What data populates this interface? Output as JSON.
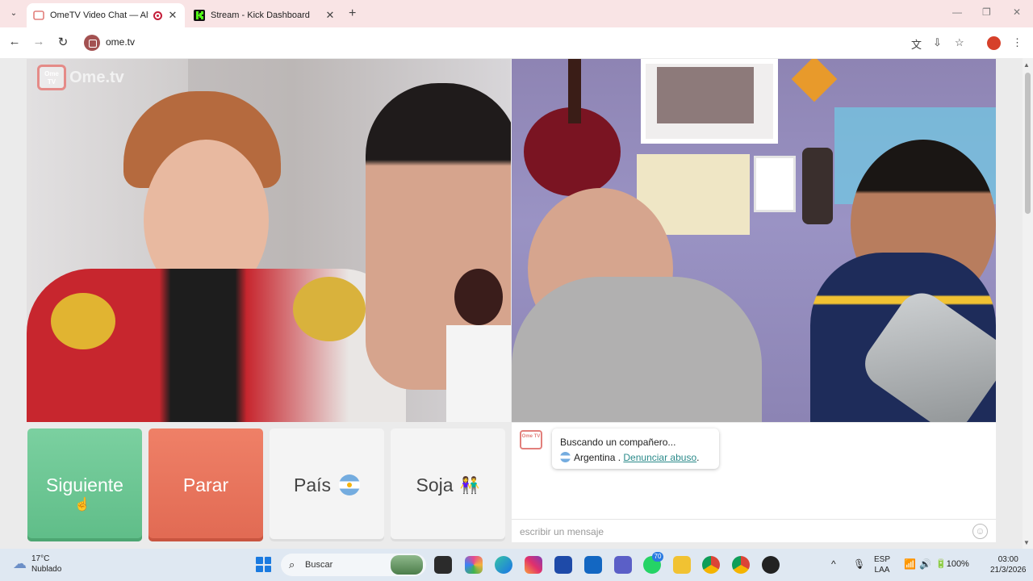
{
  "browser": {
    "tabs": [
      {
        "title": "OmeTV Video Chat — Alter",
        "active": true
      },
      {
        "title": "Stream - Kick Dashboard",
        "active": false
      }
    ],
    "url": "ome.tv"
  },
  "site": {
    "logo_text": "Ome.tv",
    "logo_badge": "Ome TV"
  },
  "controls": {
    "next_label": "Siguiente",
    "stop_label": "Parar",
    "country_label": "País",
    "gender_label": "Soja"
  },
  "chat": {
    "status": "Buscando un compañero...",
    "country": "Argentina",
    "separator": " . ",
    "report_label": "Denunciar abuso",
    "report_suffix": ".",
    "input_placeholder": "escribir un mensaje"
  },
  "taskbar": {
    "temp": "17°C",
    "weather": "Nublado",
    "search_label": "Buscar",
    "whatsapp_badge": "70",
    "lang1": "ESP",
    "lang2": "LAA",
    "battery": "100%",
    "time": "03:00",
    "date": "21/3/2026"
  },
  "colors": {
    "next": "#6fc694",
    "stop": "#e8735c",
    "ome_red": "#e27f7b",
    "link": "#2a8a8a"
  }
}
